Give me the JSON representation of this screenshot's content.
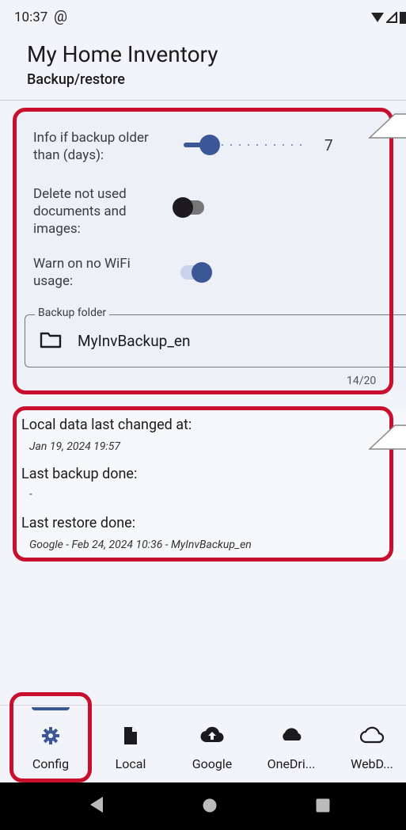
{
  "status_bar": {
    "time": "10:37",
    "at_icon": "@"
  },
  "header": {
    "title": "My Home Inventory",
    "subtitle": "Backup/restore"
  },
  "settings": {
    "backup_age_label": "Info if backup older than (days):",
    "backup_age_value": "7",
    "backup_age_fraction": 0.18,
    "delete_unused_label": "Delete not used documents and images:",
    "delete_unused_on": false,
    "warn_wifi_label": "Warn on no WiFi usage:",
    "warn_wifi_on": true,
    "backup_folder_label": "Backup folder",
    "backup_folder_value": "MyInvBackup_en",
    "backup_folder_count": "14/20"
  },
  "info": {
    "local_changed_label": "Local data last changed at:",
    "local_changed_value": "Jan 19, 2024 19:57",
    "last_backup_label": "Last backup done:",
    "last_backup_value": "-",
    "last_restore_label": "Last restore done:",
    "last_restore_value": "Google - Feb 24, 2024 10:36 - MyInvBackup_en"
  },
  "nav": {
    "items": [
      {
        "label": "Config",
        "icon": "gear-icon",
        "selected": true
      },
      {
        "label": "Local",
        "icon": "file-icon"
      },
      {
        "label": "Google",
        "icon": "cloud-upload-icon"
      },
      {
        "label": "OneDri...",
        "icon": "cloud-filled-icon"
      },
      {
        "label": "WebD...",
        "icon": "cloud-outline-icon"
      }
    ]
  },
  "colors": {
    "accent": "#3b5796",
    "highlight": "#c8102e"
  }
}
